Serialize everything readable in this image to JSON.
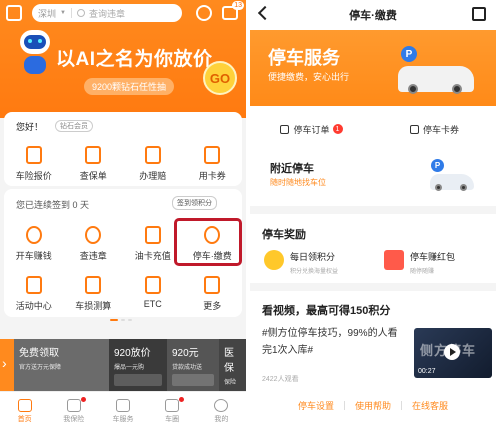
{
  "left": {
    "search": {
      "city": "深圳",
      "placeholder": "查询违章"
    },
    "msg_badge": "13",
    "banner": {
      "title": "以AI之名为你放价",
      "subtitle": "9200颗钻石任性抽",
      "go_label": "GO"
    },
    "greeting": "您好！",
    "member_badge": "钻石会员",
    "row1": [
      {
        "label": "车险报价",
        "icon": "shield-icon"
      },
      {
        "label": "查保单",
        "icon": "document-icon"
      },
      {
        "label": "办理赔",
        "icon": "claim-icon"
      },
      {
        "label": "用卡券",
        "icon": "coupon-icon"
      }
    ],
    "signin_text": "您已连续签到 0 天",
    "signin_button": "签到领积分",
    "row2": [
      {
        "label": "开车赚钱",
        "icon": "car-money-icon"
      },
      {
        "label": "查违章",
        "icon": "violation-icon"
      },
      {
        "label": "油卡充值",
        "icon": "fuel-card-icon"
      },
      {
        "label": "停车·缴费",
        "icon": "parking-icon"
      }
    ],
    "row3": [
      {
        "label": "活动中心",
        "icon": "gift-icon"
      },
      {
        "label": "车损测算",
        "icon": "calculator-icon"
      },
      {
        "label": "ETC",
        "icon": "etc-icon"
      },
      {
        "label": "更多",
        "icon": "more-grid-icon"
      }
    ],
    "strip": [
      {
        "title": "免费领取",
        "sub": "官方送万元保障",
        "color": "#6b6b6b"
      },
      {
        "title": "920放价",
        "sub": "爆品一元购",
        "color": "#3a3a3a"
      },
      {
        "title": "920元",
        "sub": "贷款成功送",
        "color": "#555555"
      },
      {
        "title": "医保",
        "sub": "保险",
        "color": "#444444"
      }
    ],
    "tabs": [
      {
        "label": "首页",
        "icon": "home-icon",
        "active": true
      },
      {
        "label": "我保险",
        "icon": "insurance-icon",
        "active": false
      },
      {
        "label": "车服务",
        "icon": "car-service-icon",
        "active": false
      },
      {
        "label": "车圈",
        "icon": "community-icon",
        "active": false
      },
      {
        "label": "我的",
        "icon": "profile-icon",
        "active": false
      }
    ]
  },
  "right": {
    "title": "停车·缴费",
    "banner": {
      "title": "停车服务",
      "subtitle": "便捷缴费，安心出行",
      "p_label": "P"
    },
    "tabs": {
      "orders": "停车订单",
      "orders_badge": "1",
      "coupons": "停车卡券"
    },
    "nearby": {
      "title": "附近停车",
      "subtitle": "随时随地找车位"
    },
    "reward_title": "停车奖励",
    "rewards": [
      {
        "name": "每日领积分",
        "sub": "积分兑换海量权益",
        "color": "#ffc82a"
      },
      {
        "name": "停车赚红包",
        "sub": "随停随赚",
        "color": "#ff5a4a"
      }
    ],
    "video": {
      "title": "看视频，最高可得150积分",
      "desc": "#侧方位停车技巧，99%的人看完1次入库#",
      "views": "2422人观看",
      "thumb_text": "侧方停车",
      "duration": "00:27"
    },
    "footer": [
      "停车设置",
      "使用帮助",
      "在线客服"
    ],
    "accent": "#ff8a1e"
  }
}
